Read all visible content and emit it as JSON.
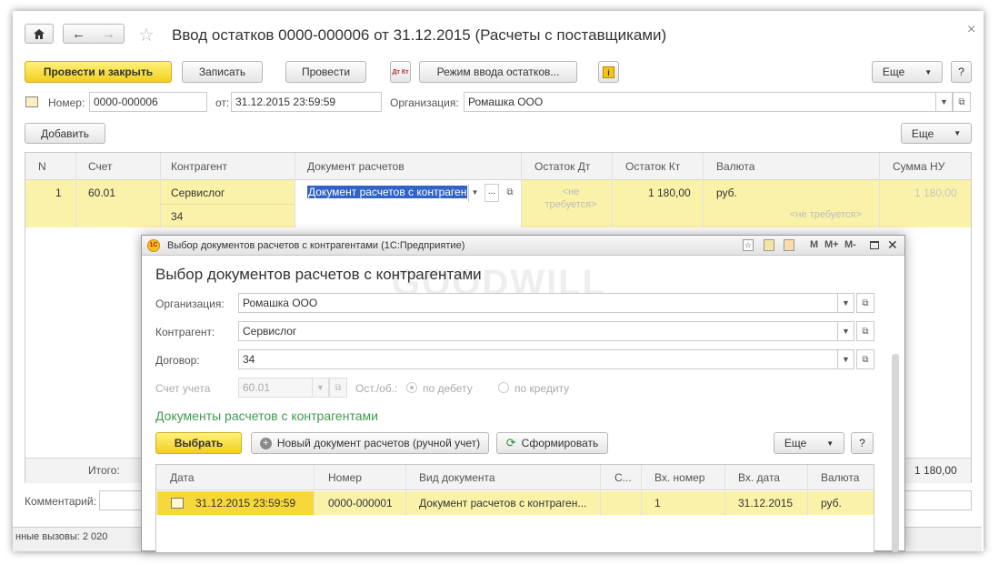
{
  "main": {
    "title": "Ввод остатков 0000-000006 от 31.12.2015 (Расчеты с поставщиками)",
    "close_icon": "×",
    "toolbar": {
      "post_close": "Провести и закрыть",
      "save": "Записать",
      "post": "Провести",
      "dtkt_icon": "Дт Кт",
      "mode": "Режим ввода остатков...",
      "more": "Еще",
      "help": "?"
    },
    "number_label": "Номер:",
    "number": "0000-000006",
    "from_label": "от:",
    "date": "31.12.2015 23:59:59",
    "org_label": "Организация:",
    "org": "Ромашка ООО",
    "add": "Добавить",
    "more2": "Еще",
    "table": {
      "headers": [
        "N",
        "Счет",
        "Контрагент",
        "Документ расчетов",
        "Остаток Дт",
        "Остаток Кт",
        "Валюта",
        "Сумма НУ"
      ],
      "row": {
        "n": "1",
        "account": "60.01",
        "counterparty": "Сервислог",
        "contract": "34",
        "doc": "Документ расчетов с контраген",
        "dt": "<не требуется>",
        "kt": "1 180,00",
        "currency": "руб.",
        "currency_note": "<не требуется>",
        "nu": "1 180,00"
      }
    },
    "total_label": "Итого:",
    "total_nu": "1 180,00",
    "comment_label": "Комментарий:",
    "status": "нные вызовы: 2 020"
  },
  "dialog": {
    "window_title": "Выбор документов расчетов с контрагентами (1С:Предприятие)",
    "header_buttons": [
      "M",
      "M+",
      "M-"
    ],
    "heading": "Выбор документов расчетов с контрагентами",
    "org_label": "Организация:",
    "org": "Ромашка ООО",
    "cp_label": "Контрагент:",
    "cp": "Сервислог",
    "contract_label": "Договор:",
    "contract": "34",
    "account_label": "Счет учета",
    "account": "60.01",
    "balance_label": "Ост./об.:",
    "debit": "по дебету",
    "credit": "по кредиту",
    "section": "Документы расчетов с контрагентами",
    "select": "Выбрать",
    "new_doc": "Новый документ расчетов (ручной учет)",
    "form": "Сформировать",
    "more": "Еще",
    "help": "?",
    "table": {
      "headers": [
        "Дата",
        "Номер",
        "Вид документа",
        "С...",
        "Вх. номер",
        "Вх. дата",
        "Валюта"
      ],
      "row": {
        "date": "31.12.2015 23:59:59",
        "number": "0000-000001",
        "kind": "Документ расчетов с контраген...",
        "in_number": "1",
        "in_date": "31.12.2015",
        "currency": "руб."
      }
    },
    "watermark": "GOODWILL"
  },
  "colors": {
    "accent_yellow": "#fbf2a9",
    "button_yellow": "#f7d83a",
    "section_green": "#3f9a4e"
  }
}
